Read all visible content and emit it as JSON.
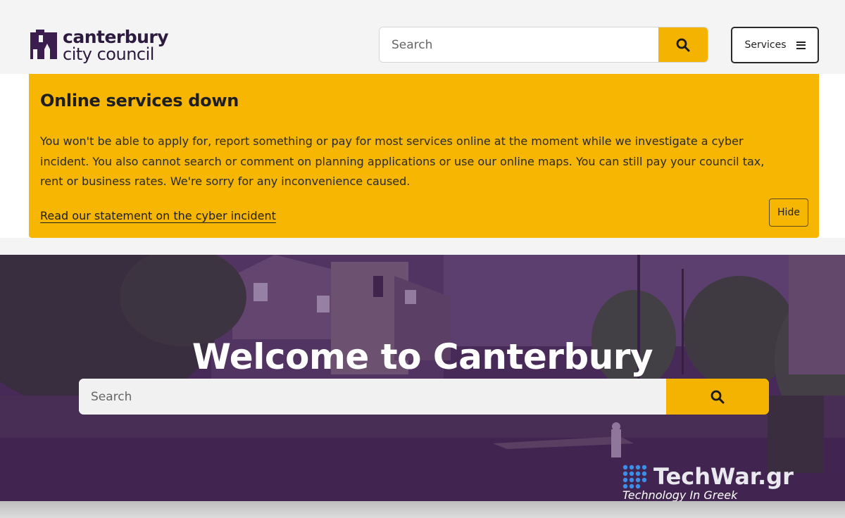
{
  "header": {
    "logo": {
      "line1": "canterbury",
      "line2": "city council"
    },
    "search": {
      "placeholder": "Search"
    },
    "services_label": "Services"
  },
  "alert": {
    "title": "Online services down",
    "body": "You won't be able to apply for, report something or pay for most services online at the moment while we investigate a cyber incident. You also cannot search or comment on planning applications or use our online maps. You can still pay your council tax, rent or business rates. We're sorry for any inconvenience caused.",
    "link": "Read our statement on the cyber incident",
    "hide_label": "Hide"
  },
  "hero": {
    "title_prefix": "Welcome to ",
    "title_bold": "Canterbury",
    "search": {
      "placeholder": "Search"
    }
  },
  "watermark": {
    "brand": "TechWar.gr",
    "tagline": "Technology In Greek"
  },
  "colors": {
    "accent": "#f5b301",
    "brand_purple": "#3b1e4f",
    "alert_bg": "#f6b602"
  },
  "icons": {
    "search": "search-icon",
    "menu": "hamburger-icon",
    "logo": "cathedral-logo-icon"
  }
}
